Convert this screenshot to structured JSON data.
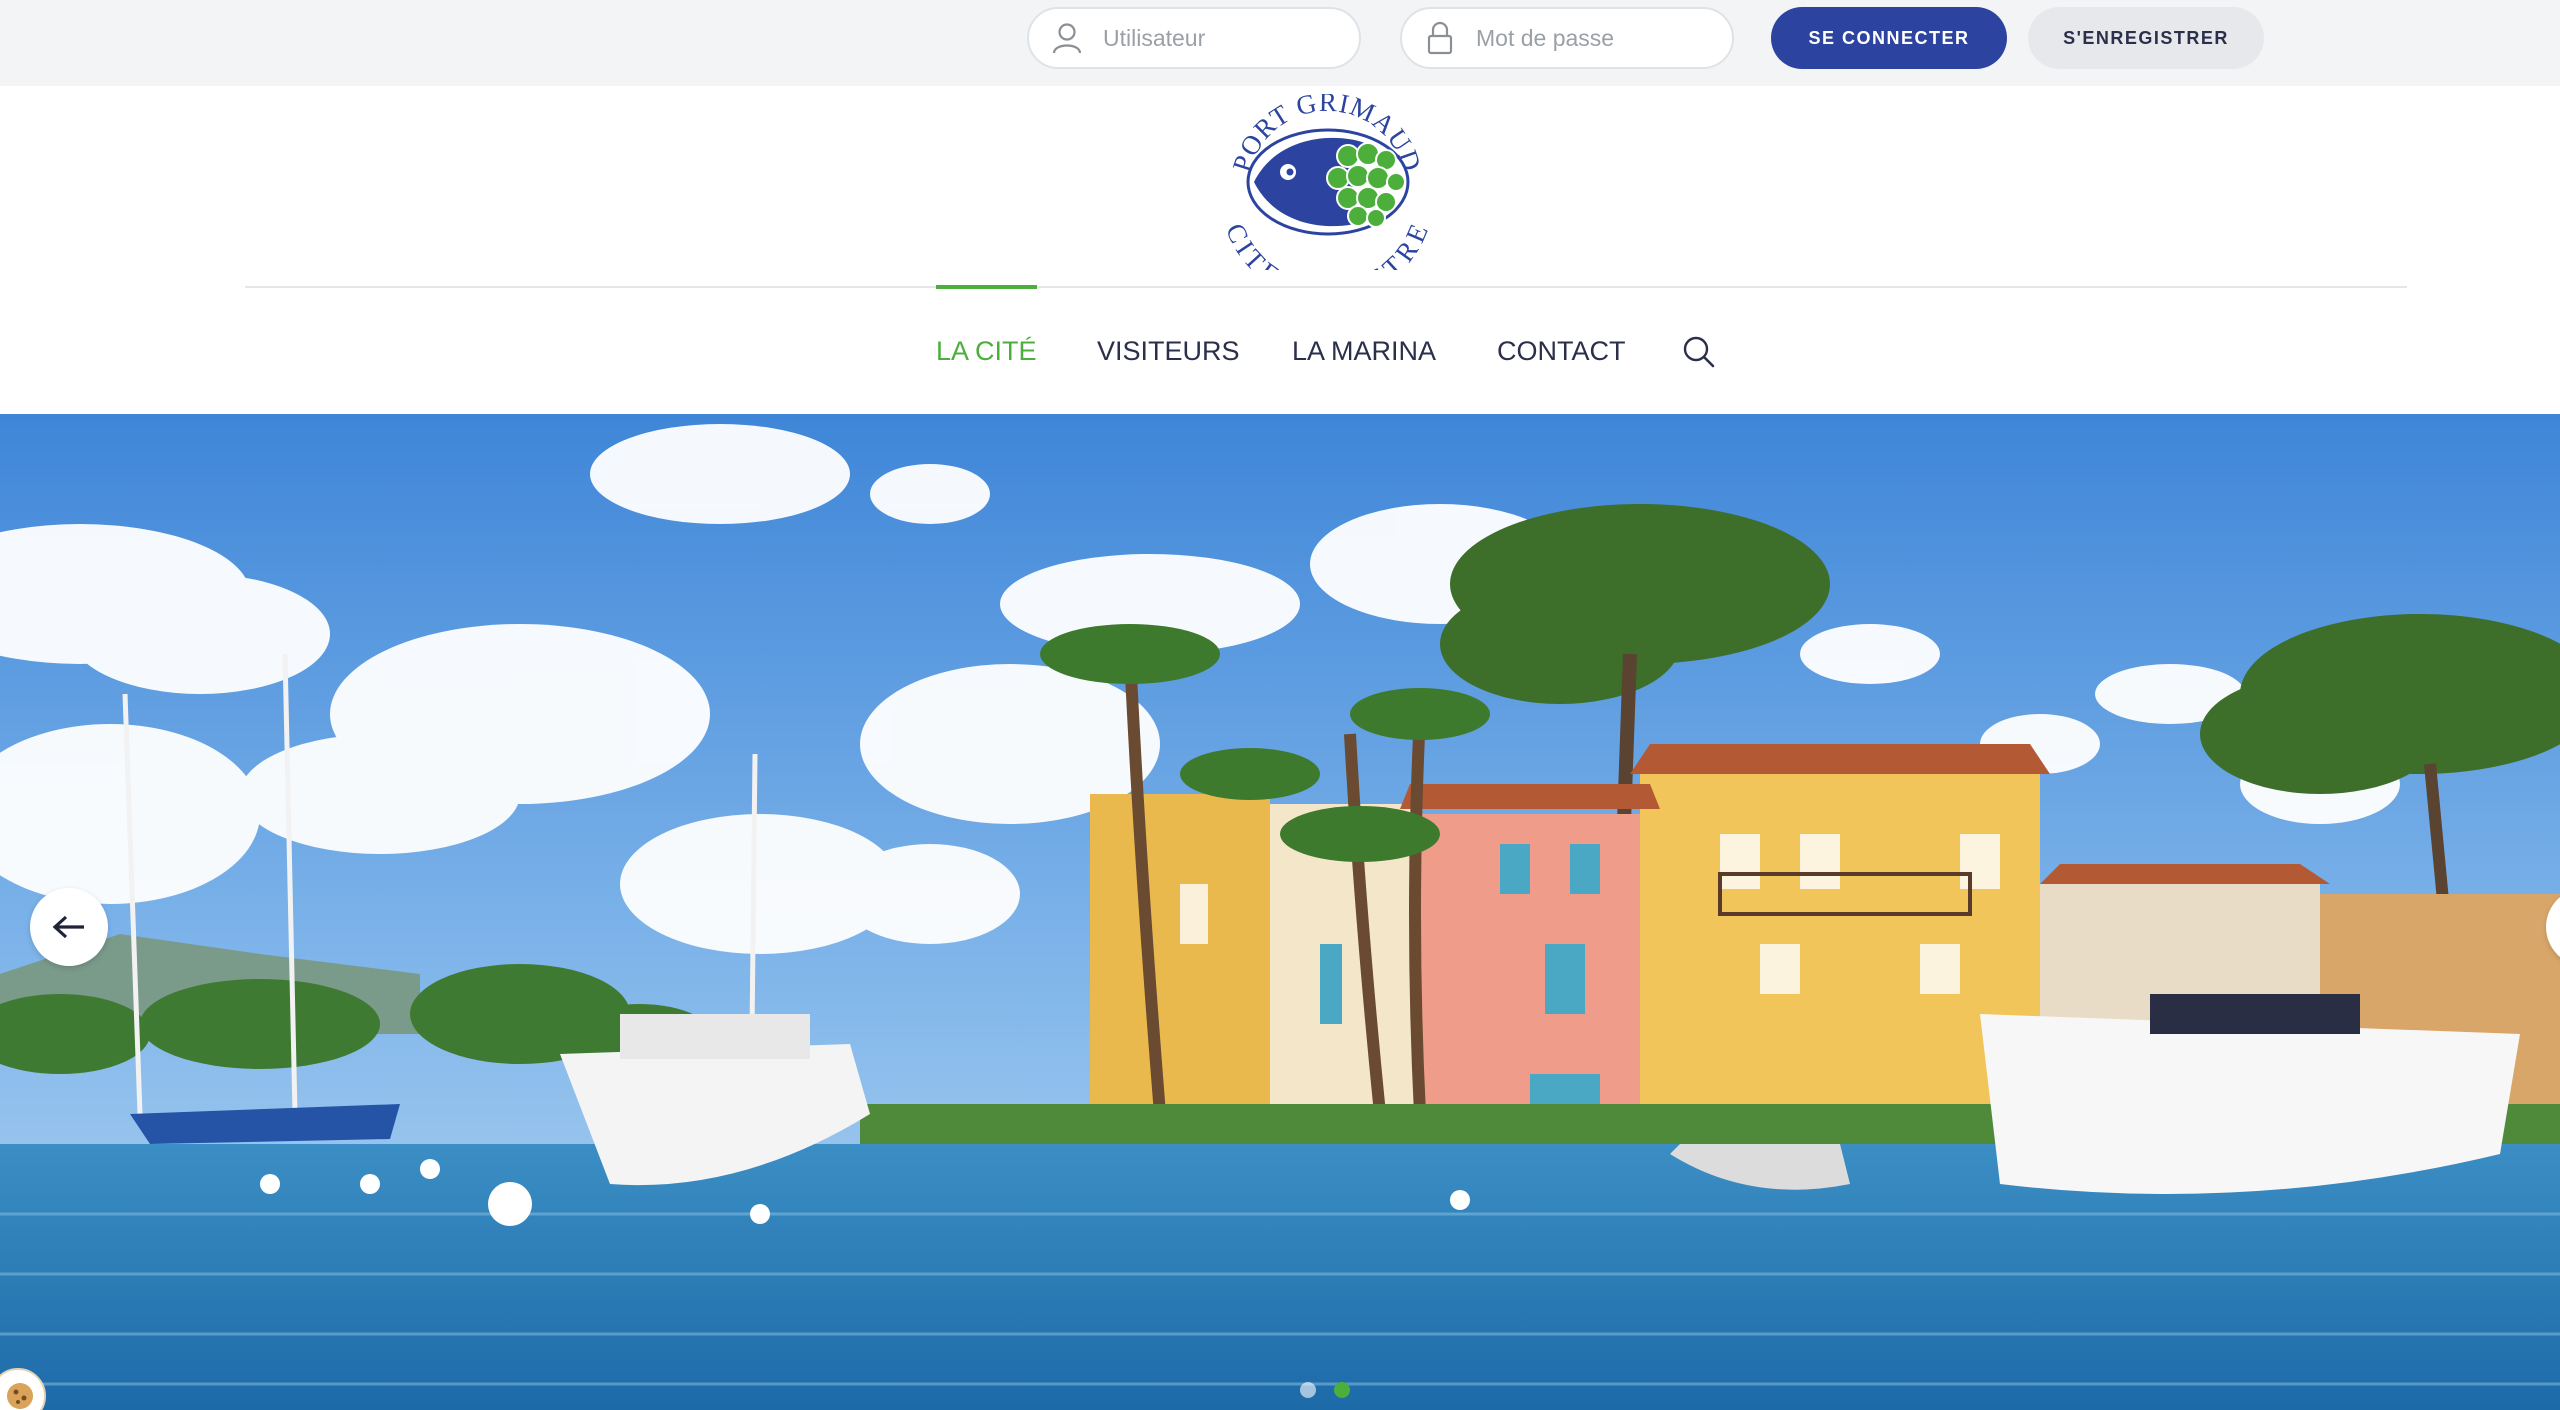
{
  "login": {
    "username_placeholder": "Utilisateur",
    "password_placeholder": "Mot de passe",
    "login_label": "SE CONNECTER",
    "register_label": "S'ENREGISTRER"
  },
  "logo": {
    "text_top": "PORT GRIMAUD",
    "text_bottom": "CITE LACUSTRE"
  },
  "nav": {
    "items": [
      {
        "label": "LA CITÉ",
        "active": true
      },
      {
        "label": "VISITEURS",
        "active": false
      },
      {
        "label": "LA MARINA",
        "active": false
      },
      {
        "label": "CONTACT",
        "active": false
      }
    ],
    "search_icon": "search-icon"
  },
  "hero": {
    "image": "Port Grimaud waterfront with colorful houses, palm trees and yachts",
    "slides_total": 2,
    "active_slide": 2
  },
  "colors": {
    "brand_blue": "#2c44a0",
    "active_green": "#4caf3c",
    "nav_text": "#2b2f4a",
    "topbar_bg": "#f3f4f6"
  }
}
